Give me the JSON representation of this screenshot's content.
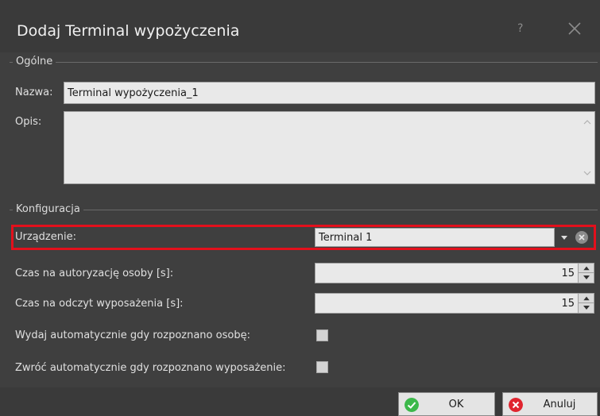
{
  "window": {
    "title": "Dodaj Terminal wypożyczenia",
    "help_glyph": "?"
  },
  "general": {
    "group_label": "Ogólne",
    "name_label": "Nazwa:",
    "name_value": "Terminal wypożyczenia_1",
    "desc_label": "Opis:",
    "desc_value": ""
  },
  "config": {
    "group_label": "Konfiguracja",
    "device_label": "Urządzenie:",
    "device_value": "Terminal 1",
    "auth_time_label": "Czas na autoryzację osoby [s]:",
    "auth_time_value": "15",
    "read_time_label": "Czas na odczyt wyposażenia [s]:",
    "read_time_value": "15",
    "auto_issue_label": "Wydaj automatycznie gdy rozpoznano osobę:",
    "auto_issue_checked": false,
    "auto_return_label": "Zwróć automatycznie gdy rozpoznano wyposażenie:",
    "auto_return_checked": false
  },
  "footer": {
    "ok_label": "OK",
    "cancel_label": "Anuluj"
  },
  "colors": {
    "highlight": "#e3101c",
    "ok_icon": "#3cb84a",
    "cancel_icon": "#e0242e"
  }
}
